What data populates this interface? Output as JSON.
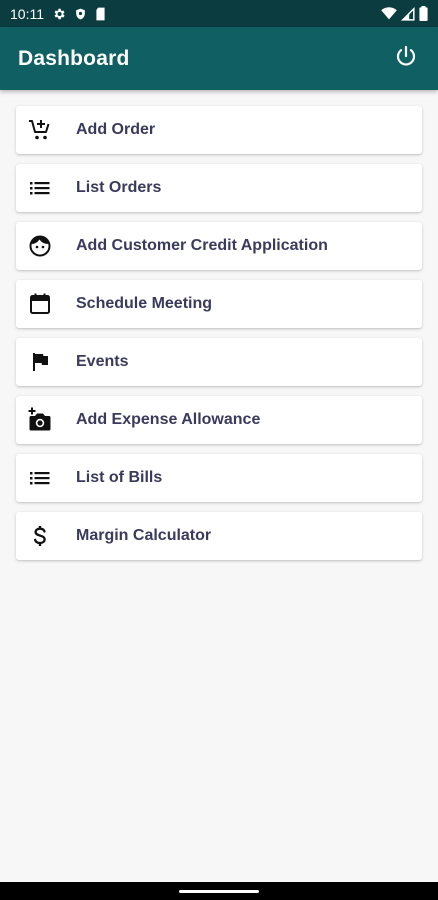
{
  "status_bar": {
    "time": "10:11",
    "icons": [
      "gear-icon",
      "shield-icon",
      "sim-card-icon",
      "wifi-icon",
      "signal-icon",
      "battery-icon"
    ]
  },
  "app_bar": {
    "title": "Dashboard",
    "logout_icon": "power-icon"
  },
  "menu": {
    "items": [
      {
        "label": "Add Order",
        "icon": "cart-plus-icon"
      },
      {
        "label": "List Orders",
        "icon": "list-icon"
      },
      {
        "label": "Add Customer Credit Application",
        "icon": "face-icon"
      },
      {
        "label": "Schedule Meeting",
        "icon": "calendar-icon"
      },
      {
        "label": "Events",
        "icon": "flag-icon"
      },
      {
        "label": "Add Expense Allowance",
        "icon": "add-camera-icon"
      },
      {
        "label": "List of Bills",
        "icon": "list-icon"
      },
      {
        "label": "Margin Calculator",
        "icon": "dollar-icon"
      }
    ]
  },
  "colors": {
    "status_bar": "#0b3d40",
    "app_bar": "#0f5f63",
    "menu_text": "#3a3a5c",
    "background": "#f7f7f7"
  }
}
